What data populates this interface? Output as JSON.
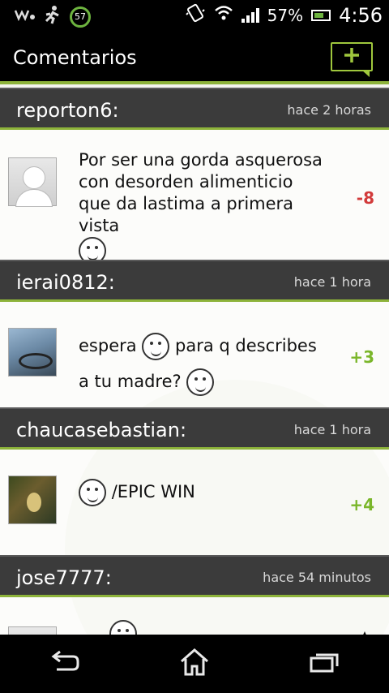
{
  "status_bar": {
    "battery_percent": "57%",
    "time": "4:56",
    "timer_badge": "57",
    "icons": [
      "walkman-icon",
      "running-man-icon",
      "timer-icon",
      "vibrate-icon",
      "wifi-icon",
      "signal-icon",
      "battery-icon"
    ]
  },
  "action_bar": {
    "title": "Comentarios",
    "add_icon": "add-comment-icon"
  },
  "comments": [
    {
      "user": "reporton6:",
      "time_ago": "hace 2 horas",
      "text": "Por ser una gorda asquerosa con desorden alimenticio que da lastima a primera vista",
      "score": "-8",
      "score_type": "neg"
    },
    {
      "user": "ierai0812:",
      "time_ago": "hace 1 hora",
      "text_a": "espera",
      "text_b": "para q describes a tu madre?",
      "score": "+3",
      "score_type": "pos"
    },
    {
      "user": "chaucasebastian:",
      "time_ago": "hace 1 hora",
      "text": "/EPIC WIN",
      "score": "+4",
      "score_type": "pos"
    },
    {
      "user": "jose7777:",
      "time_ago": "hace 54 minutos"
    }
  ],
  "nav": {
    "back_icon": "back-icon",
    "home_icon": "home-icon",
    "recents_icon": "recents-icon"
  }
}
